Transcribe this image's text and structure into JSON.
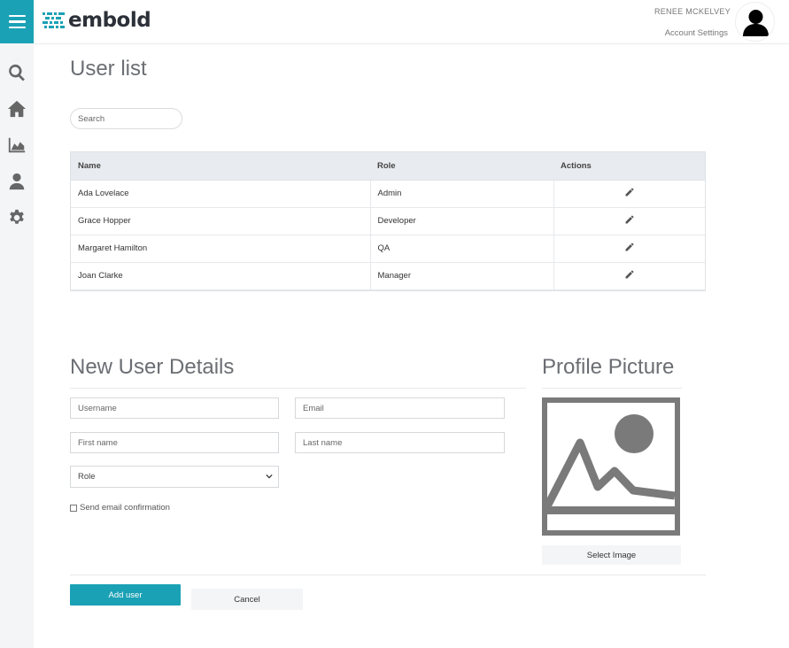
{
  "app": {
    "brand": "embold",
    "accent_color": "#1aa1b5"
  },
  "header": {
    "user_name": "RENEE MCKELVEY",
    "account_settings": "Account Settings"
  },
  "sidebar": {
    "items": [
      {
        "icon": "search-icon"
      },
      {
        "icon": "home-icon"
      },
      {
        "icon": "area-chart-icon"
      },
      {
        "icon": "user-icon"
      },
      {
        "icon": "gear-icon"
      }
    ]
  },
  "user_list": {
    "title": "User list",
    "search_placeholder": "Search",
    "columns": [
      "Name",
      "Role",
      "Actions"
    ],
    "rows": [
      {
        "name": "Ada Lovelace",
        "role": "Admin"
      },
      {
        "name": "Grace Hopper",
        "role": "Developer"
      },
      {
        "name": "Margaret Hamilton",
        "role": "QA"
      },
      {
        "name": "Joan Clarke",
        "role": "Manager"
      }
    ]
  },
  "new_user": {
    "title": "New User Details",
    "username_placeholder": "Username",
    "email_placeholder": "Email",
    "first_name_placeholder": "First name",
    "last_name_placeholder": "Last name",
    "role_selected": "Role",
    "send_email_label": "Send email confirmation",
    "send_email_checked": false
  },
  "profile_picture": {
    "title": "Profile Picture",
    "select_image_label": "Select Image"
  },
  "actions": {
    "add_user_label": "Add user",
    "cancel_label": "Cancel"
  }
}
